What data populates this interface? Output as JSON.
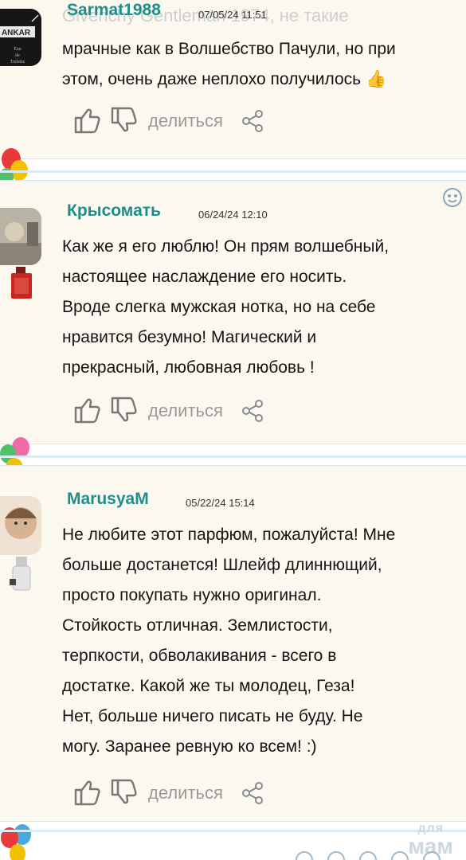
{
  "comments": [
    {
      "username": "Sarmat1988",
      "date": "07/05/24 11:51",
      "ghost_text": "Givenchy Gentleman 1974, не такие",
      "text": "мрачные как в Волшебство Пачули, но при\nэтом, очень даже неплохо получилось 👍",
      "share_label": "делиться"
    },
    {
      "username": "Крысомать",
      "date": "06/24/24 12:10",
      "text": "Как же я его люблю! Он прям волшебный,\nнастоящее наслаждение его носить.\nВроде слегка мужская нотка, но на себе\nнравится безумно! Магический и\nпрекрасный, любовная любовь !",
      "share_label": "делиться"
    },
    {
      "username": "MarusyaM",
      "date": "05/22/24 15:14",
      "text": "Не любите этот парфюм, пожалуйста! Мне\nбольше достанется! Шлейф длиннющий,\nпросто покупать нужно оригинал.\nСтойкость отличная. Землистости,\nтерпкости, обволакивания - всего в\nдостатке. Какой же ты молодец, Геза!\nНет, больше ничего писать не буду. Не\nмогу. Заранее ревную ко всем! :)",
      "share_label": "делиться"
    }
  ],
  "avatar1_brand": "ANKAR",
  "avatar1_sub": "PARIS",
  "avatar1_label": "Eau\nde\nToilette",
  "watermark": {
    "line1": "для",
    "line2": "мам"
  },
  "colors": {
    "username": "#1f8e8a",
    "share": "#9a9a9a",
    "card_bg": "#fbf8f0"
  },
  "icons": [
    "thumbs-up-icon",
    "thumbs-down-icon",
    "share-icon",
    "emoji-icon",
    "balloon-icon"
  ]
}
